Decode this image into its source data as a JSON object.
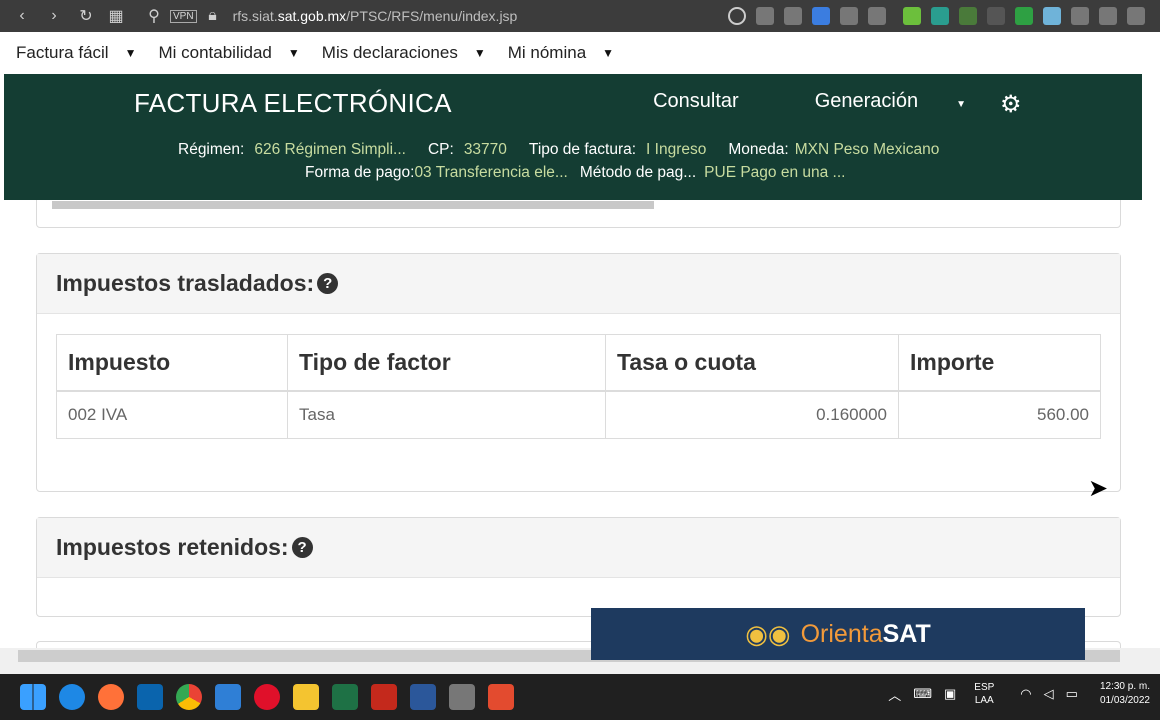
{
  "browser": {
    "back_icon": "‹",
    "forward_icon": "›",
    "reload_icon": "↻",
    "vpn_label": "VPN",
    "url_prefix": "rfs.siat.",
    "url_domain": "sat.gob.mx",
    "url_path": "/PTSC/RFS/menu/index.jsp"
  },
  "app_menu": {
    "items": [
      "Factura fácil",
      "Mi contabilidad",
      "Mis declaraciones",
      "Mi nómina"
    ]
  },
  "sat_header": {
    "title": "FACTURA ELECTRÓNICA",
    "nav_consultar": "Consultar",
    "nav_generacion": "Generación",
    "regimen_label": "Régimen:",
    "regimen_value": "626 Régimen Simpli...",
    "cp_label": "CP:",
    "cp_value": "33770",
    "tipo_label": "Tipo de factura:",
    "tipo_value": "I Ingreso",
    "moneda_label": "Moneda:",
    "moneda_value": "MXN Peso Mexicano",
    "forma_label": "Forma de pago:",
    "forma_value": "03 Transferencia ele...",
    "metodo_label": "Método de pag...",
    "metodo_value": "PUE Pago en una ..."
  },
  "trasladados": {
    "title": "Impuestos trasladados:",
    "headers": [
      "Impuesto",
      "Tipo de factor",
      "Tasa o cuota",
      "Importe"
    ],
    "rows": [
      [
        "002 IVA",
        "Tasa",
        "0.160000",
        "560.00"
      ]
    ]
  },
  "retenidos": {
    "title": "Impuestos retenidos:"
  },
  "banner": {
    "part1": "Orienta",
    "part2": "SAT"
  },
  "taskbar": {
    "lang_top": "ESP",
    "lang_bottom": "LAA",
    "time": "12:30 p. m.",
    "date": "01/03/2022"
  },
  "colors": {
    "header_bg": "#143d33",
    "header_value": "#c8dca0",
    "banner_bg": "#1e3a5f",
    "banner_orange": "#f29a3a"
  }
}
